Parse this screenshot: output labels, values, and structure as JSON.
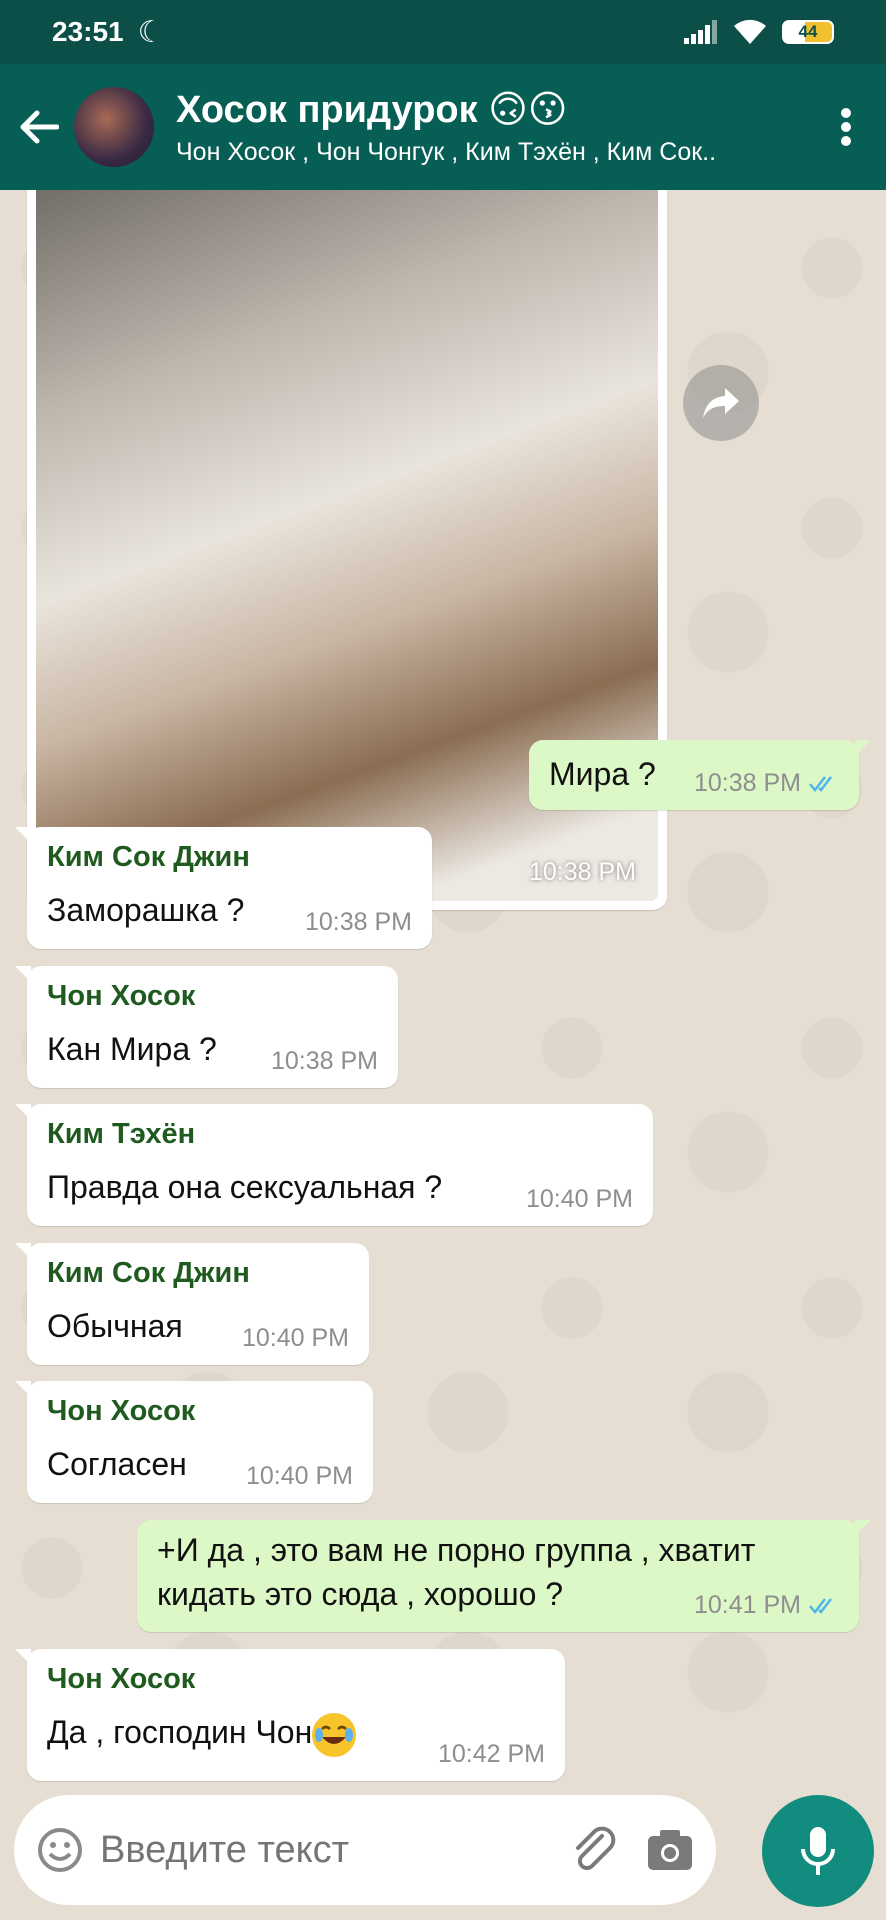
{
  "status_bar": {
    "time": "23:51",
    "battery": "44"
  },
  "header": {
    "title": "Хосок придурок 🙃😗",
    "subtitle": "Чон Хосок , Чон Чонгук , Ким Тэхён , Ким Сок.."
  },
  "image_message": {
    "time": "10:38 PM"
  },
  "messages": [
    {
      "type": "out",
      "text": "Мира ?",
      "time": "10:38 PM"
    },
    {
      "type": "in",
      "sender": "Ким Сок Джин",
      "text": "Заморашка ?",
      "time": "10:38 PM"
    },
    {
      "type": "in",
      "sender": "Чон Хосок",
      "text": "Кан Мира ?",
      "time": "10:38 PM"
    },
    {
      "type": "in",
      "sender": "Ким Тэхён",
      "text": "Правда она сексуальная ?",
      "time": "10:40 PM"
    },
    {
      "type": "in",
      "sender": "Ким Сок Джин",
      "text": "Обычная",
      "time": "10:40 PM"
    },
    {
      "type": "in",
      "sender": "Чон Хосок",
      "text": "Согласен",
      "time": "10:40 PM"
    },
    {
      "type": "out",
      "text_line1": "+И да , это вам не порно группа , хватит",
      "text_line2": "кидать это сюда , хорошо ?",
      "time": "10:41 PM"
    },
    {
      "type": "in",
      "sender": "Чон Хосок",
      "text": "Да , господин Чон",
      "time": "10:42 PM"
    }
  ],
  "input": {
    "placeholder": "Введите текст"
  },
  "colors": {
    "header": "#075e54",
    "status": "#0b4f48",
    "outgoing": "#dcf8c6",
    "incoming": "#ffffff",
    "mic": "#128c7e",
    "sender": "#1f5a1f"
  }
}
